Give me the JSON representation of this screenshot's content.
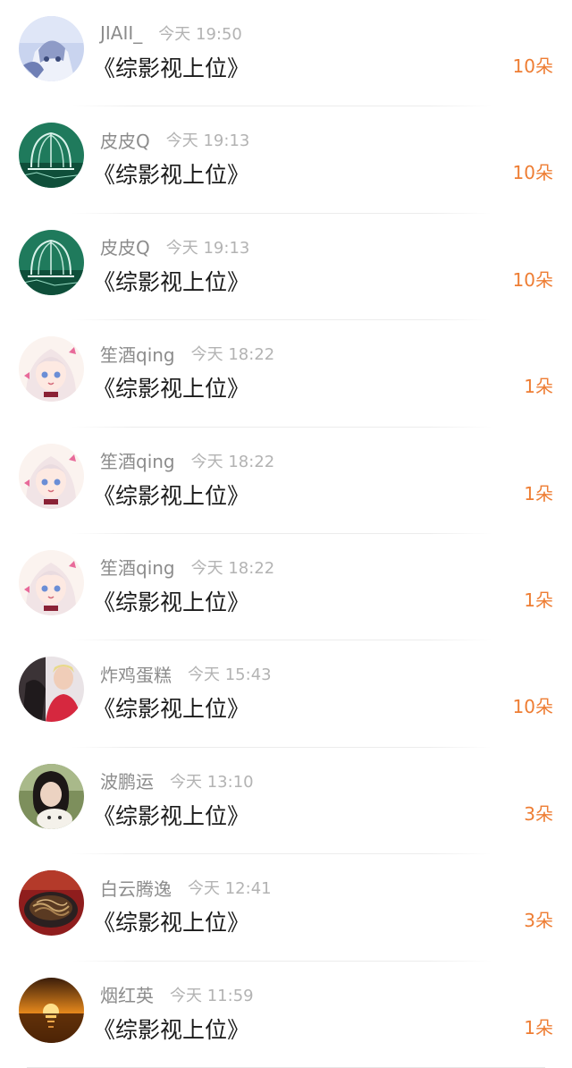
{
  "gift_list": {
    "items": [
      {
        "username": "JIAII_",
        "time": "今天 19:50",
        "title": "《综影视上位》",
        "amount": "10朵",
        "avatar_icon": "anime-girl-blue-icon"
      },
      {
        "username": "皮皮Q",
        "time": "今天 19:13",
        "title": "《综影视上位》",
        "amount": "10朵",
        "avatar_icon": "green-gazebo-icon"
      },
      {
        "username": "皮皮Q",
        "time": "今天 19:13",
        "title": "《综影视上位》",
        "amount": "10朵",
        "avatar_icon": "green-gazebo-icon"
      },
      {
        "username": "笙酒qing",
        "time": "今天 18:22",
        "title": "《综影视上位》",
        "amount": "1朵",
        "avatar_icon": "anime-girl-pink-icon"
      },
      {
        "username": "笙酒qing",
        "time": "今天 18:22",
        "title": "《综影视上位》",
        "amount": "1朵",
        "avatar_icon": "anime-girl-pink-icon"
      },
      {
        "username": "笙酒qing",
        "time": "今天 18:22",
        "title": "《综影视上位》",
        "amount": "1朵",
        "avatar_icon": "anime-girl-pink-icon"
      },
      {
        "username": "炸鸡蛋糕",
        "time": "今天 15:43",
        "title": "《综影视上位》",
        "amount": "10朵",
        "avatar_icon": "person-photo-icon"
      },
      {
        "username": "波鹏运",
        "time": "今天 13:10",
        "title": "《综影视上位》",
        "amount": "3朵",
        "avatar_icon": "girl-with-dog-icon"
      },
      {
        "username": "白云腾逸",
        "time": "今天 12:41",
        "title": "《综影视上位》",
        "amount": "3朵",
        "avatar_icon": "noodles-plate-icon"
      },
      {
        "username": "烟红英",
        "time": "今天 11:59",
        "title": "《综影视上位》",
        "amount": "1朵",
        "avatar_icon": "sunset-sea-icon"
      }
    ]
  },
  "colors": {
    "amount": "#ee7d33",
    "username": "#8c8c8c",
    "time": "#b3b3b3",
    "title": "#1a1a1a"
  }
}
